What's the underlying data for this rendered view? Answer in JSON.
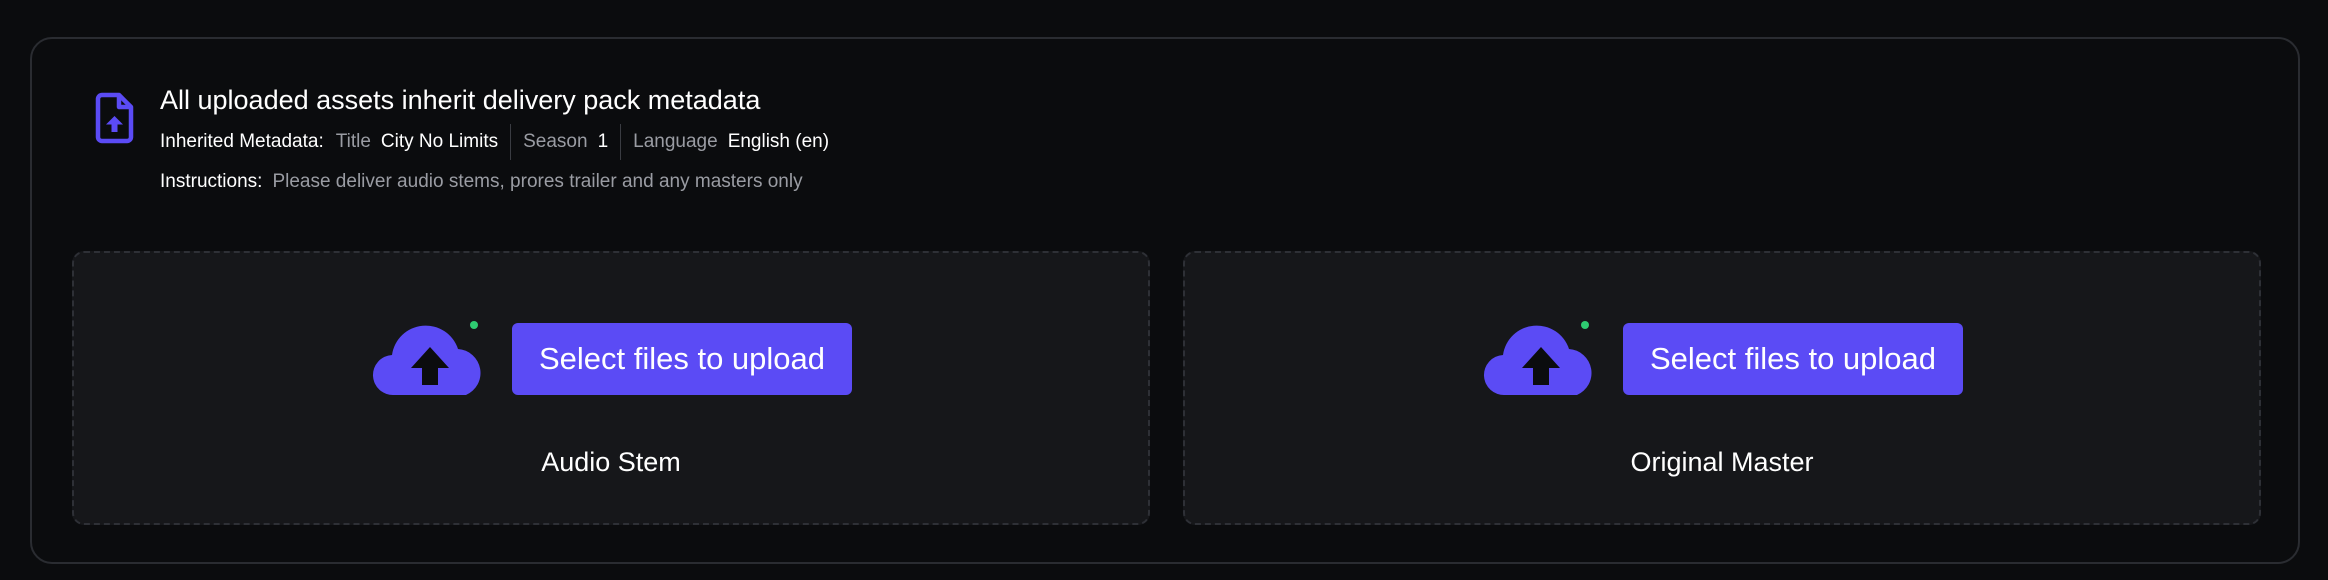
{
  "header": {
    "title": "All uploaded assets inherit delivery pack metadata",
    "inherited_label": "Inherited Metadata:",
    "metadata": [
      {
        "key": "Title",
        "value": "City No Limits"
      },
      {
        "key": "Season",
        "value": "1"
      },
      {
        "key": "Language",
        "value": "English (en)"
      }
    ],
    "instructions_label": "Instructions:",
    "instructions_text": "Please deliver audio stems, prores trailer and any masters only"
  },
  "dropzones": [
    {
      "button_label": "Select files to upload",
      "label": "Audio Stem",
      "status_color": "#2ecc71"
    },
    {
      "button_label": "Select files to upload",
      "label": "Original Master",
      "status_color": "#2ecc71"
    }
  ],
  "colors": {
    "accent": "#5b4bf5",
    "status_online": "#2ecc71"
  },
  "icons": {
    "header_icon": "file-upload-icon",
    "dropzone_icon": "cloud-upload-icon"
  }
}
